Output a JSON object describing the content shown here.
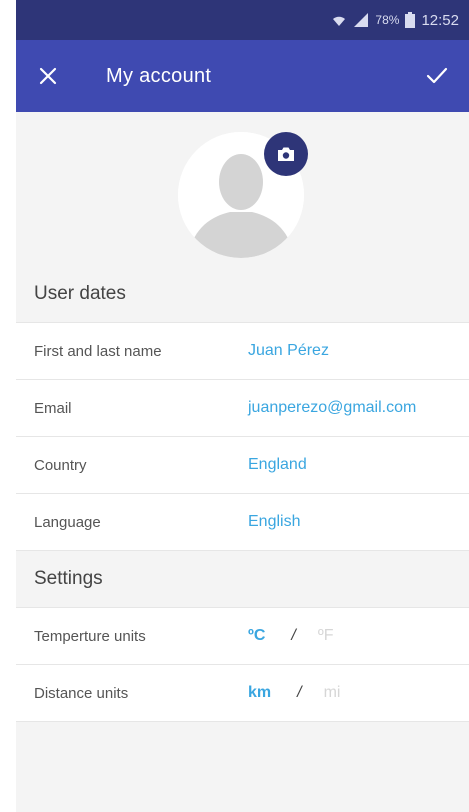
{
  "status": {
    "battery": "78%",
    "time": "12:52"
  },
  "header": {
    "title": "My account"
  },
  "user_section": {
    "title": "User dates",
    "rows": [
      {
        "label": "First and last name",
        "value": "Juan Pérez"
      },
      {
        "label": "Email",
        "value": "juanperezo@gmail.com"
      },
      {
        "label": "Country",
        "value": "England"
      },
      {
        "label": "Language",
        "value": "English"
      }
    ]
  },
  "settings_section": {
    "title": "Settings",
    "temperature": {
      "label": "Temperture units",
      "selected": "ºC",
      "other": "ºF"
    },
    "distance": {
      "label": "Distance units",
      "selected": "km",
      "other": "mi"
    }
  },
  "colors": {
    "status_bar": "#2e3578",
    "app_bar": "#3f4ab1",
    "accent": "#3aa6e0"
  }
}
